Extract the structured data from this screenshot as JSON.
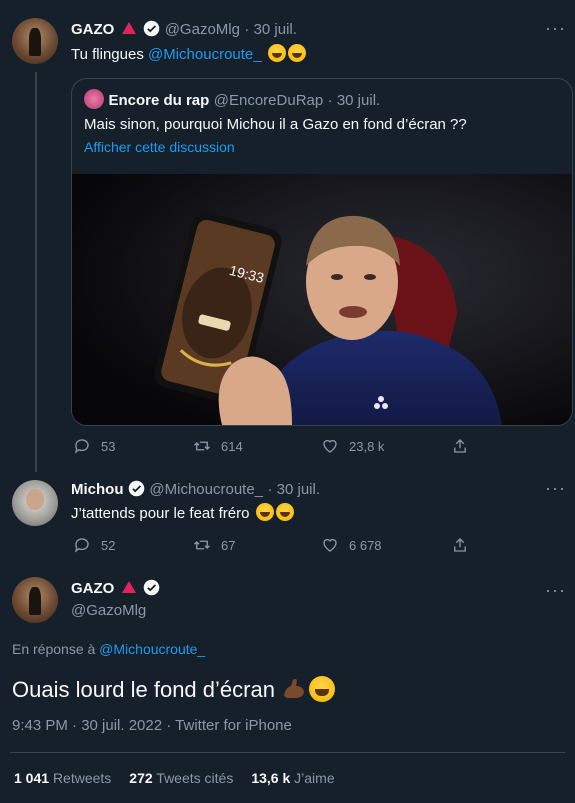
{
  "tweet1": {
    "name": "GAZO",
    "handle": "@GazoMlg",
    "date": "· 30 juil.",
    "text": "Tu flingues ",
    "mention": "@Michoucroute_",
    "quote": {
      "name": "Encore du rap",
      "handle": "@EncoreDuRap",
      "date": "· 30 juil.",
      "text": "Mais sinon, pourquoi Michou il a Gazo en fond d’écran ??",
      "show_thread": "Afficher cette discussion",
      "phone_time": "19:33"
    },
    "replies": "53",
    "retweets": "614",
    "likes": "23,8 k"
  },
  "tweet2": {
    "name": "Michou",
    "handle": "@Michoucroute_",
    "date": "· 30 juil.",
    "text": "J’tattends pour le feat fréro",
    "replies": "52",
    "retweets": "67",
    "likes": "6 678"
  },
  "main": {
    "name": "GAZO",
    "handle": "@GazoMlg",
    "reply_prefix": "En réponse à ",
    "reply_to": "@Michoucroute_",
    "text": "Ouais lourd le fond d’écran",
    "meta": "9:43 PM · 30 juil. 2022 · Twitter for iPhone",
    "stats": {
      "retweets_count": "1 041",
      "retweets_label": "Retweets",
      "quotes_count": "272",
      "quotes_label": "Tweets cités",
      "likes_count": "13,6 k",
      "likes_label": "J’aime"
    }
  },
  "colors": {
    "background": "#15202b",
    "link": "#1d9bf0",
    "muted": "#8b98a5",
    "border": "#38444d"
  }
}
